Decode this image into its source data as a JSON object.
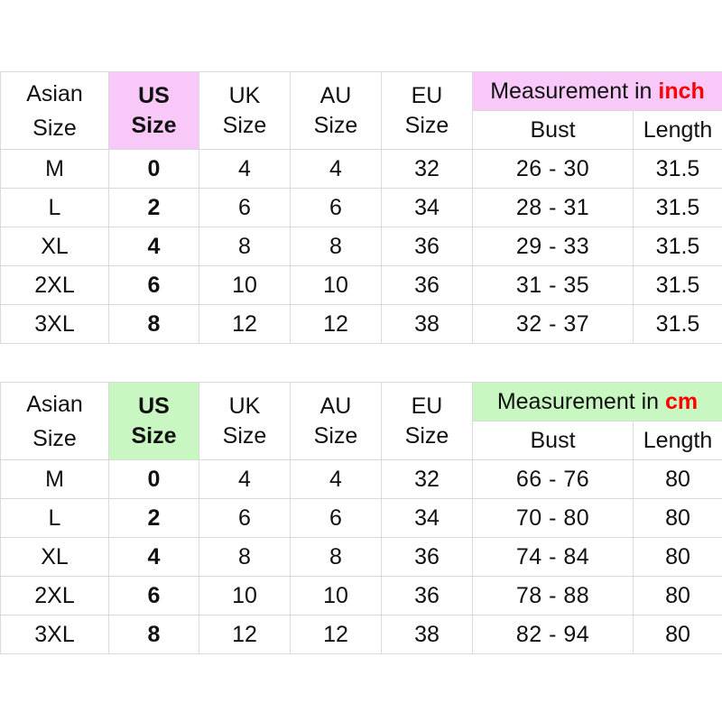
{
  "tables": [
    {
      "id": "inch",
      "header": {
        "asian": [
          "Asian",
          "Size"
        ],
        "us": [
          "US",
          "Size"
        ],
        "uk": [
          "UK",
          "Size"
        ],
        "au": [
          "AU",
          "Size"
        ],
        "eu": [
          "EU",
          "Size"
        ],
        "measurement_prefix": "Measurement in ",
        "measurement_unit": "inch",
        "bust": "Bust",
        "length": "Length"
      },
      "highlight_color": "#f8c8f8",
      "rows": [
        {
          "asian": "M",
          "us": "0",
          "uk": "4",
          "au": "4",
          "eu": "32",
          "bust": "26  - 30",
          "length": "31.5"
        },
        {
          "asian": "L",
          "us": "2",
          "uk": "6",
          "au": "6",
          "eu": "34",
          "bust": "28  - 31",
          "length": "31.5"
        },
        {
          "asian": "XL",
          "us": "4",
          "uk": "8",
          "au": "8",
          "eu": "36",
          "bust": "29  - 33",
          "length": "31.5"
        },
        {
          "asian": "2XL",
          "us": "6",
          "uk": "10",
          "au": "10",
          "eu": "36",
          "bust": "31  - 35",
          "length": "31.5"
        },
        {
          "asian": "3XL",
          "us": "8",
          "uk": "12",
          "au": "12",
          "eu": "38",
          "bust": "32  - 37",
          "length": "31.5"
        }
      ]
    },
    {
      "id": "cm",
      "header": {
        "asian": [
          "Asian",
          "Size"
        ],
        "us": [
          "US",
          "Size"
        ],
        "uk": [
          "UK",
          "Size"
        ],
        "au": [
          "AU",
          "Size"
        ],
        "eu": [
          "EU",
          "Size"
        ],
        "measurement_prefix": "Measurement in ",
        "measurement_unit": "cm",
        "bust": "Bust",
        "length": "Length"
      },
      "highlight_color": "#c9f7c2",
      "rows": [
        {
          "asian": "M",
          "us": "0",
          "uk": "4",
          "au": "4",
          "eu": "32",
          "bust": "66  - 76",
          "length": "80"
        },
        {
          "asian": "L",
          "us": "2",
          "uk": "6",
          "au": "6",
          "eu": "34",
          "bust": "70  - 80",
          "length": "80"
        },
        {
          "asian": "XL",
          "us": "4",
          "uk": "8",
          "au": "8",
          "eu": "36",
          "bust": "74  - 84",
          "length": "80"
        },
        {
          "asian": "2XL",
          "us": "6",
          "uk": "10",
          "au": "10",
          "eu": "36",
          "bust": "78  - 88",
          "length": "80"
        },
        {
          "asian": "3XL",
          "us": "8",
          "uk": "12",
          "au": "12",
          "eu": "38",
          "bust": "82  - 94",
          "length": "80"
        }
      ]
    }
  ]
}
